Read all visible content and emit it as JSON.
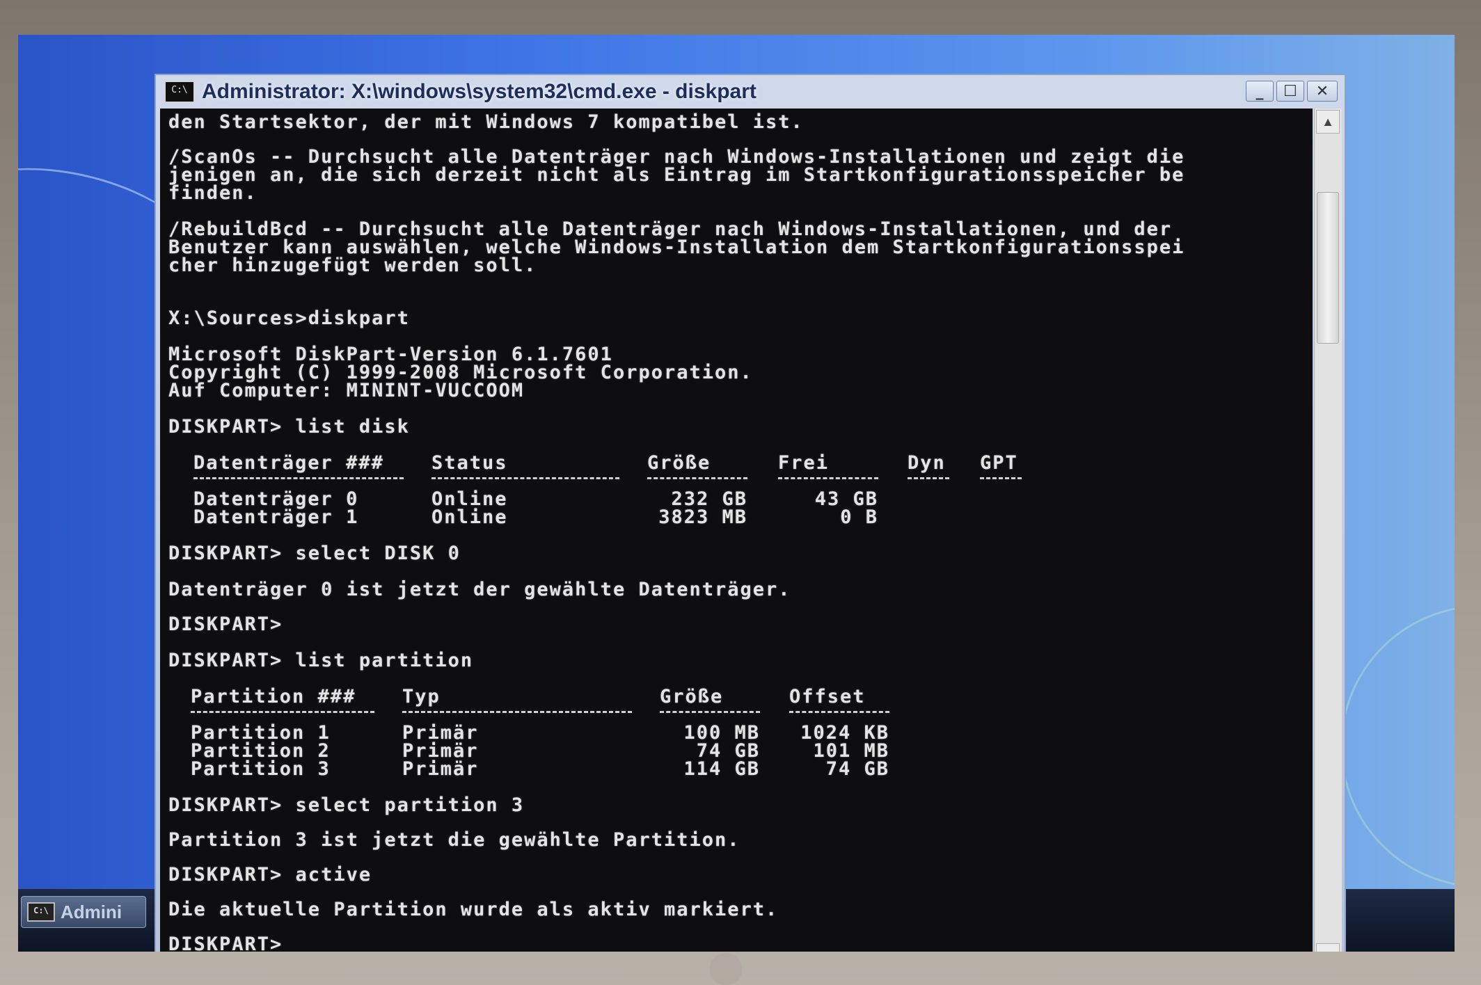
{
  "window": {
    "title": "Administrator: X:\\windows\\system32\\cmd.exe - diskpart",
    "icon_text": "C:\\",
    "controls": {
      "minimize": "_",
      "maximize": "☐",
      "close": "✕"
    }
  },
  "taskbar": {
    "button_label": "Admini",
    "button_icon_text": "C:\\"
  },
  "console": {
    "lines_top": [
      "den Startsektor, der mit Windows 7 kompatibel ist.",
      "/ScanOs -- Durchsucht alle Datenträger nach Windows-Installationen und zeigt die",
      "jenigen an, die sich derzeit nicht als Eintrag im Startkonfigurationsspeicher be",
      "finden.",
      "/RebuildBcd -- Durchsucht alle Datenträger nach Windows-Installationen, und der",
      "Benutzer kann auswählen, welche Windows-Installation dem Startkonfigurationsspei",
      "cher hinzugefügt werden soll.",
      "X:\\Sources>diskpart",
      "Microsoft DiskPart-Version 6.1.7601",
      "Copyright (C) 1999-2008 Microsoft Corporation.",
      "Auf Computer: MININT-VUCCOOM",
      "DISKPART> list disk"
    ],
    "disk_table": {
      "headers": [
        "Datenträger ###",
        "Status",
        "Größe",
        "Frei",
        "Dyn",
        "GPT"
      ],
      "rows": [
        [
          "Datenträger 0",
          "Online",
          "232 GB",
          "43 GB",
          "",
          ""
        ],
        [
          "Datenträger 1",
          "Online",
          "3823 MB",
          "0 B",
          "",
          ""
        ]
      ]
    },
    "lines_mid": [
      "DISKPART> select DISK 0",
      "Datenträger 0 ist jetzt der gewählte Datenträger.",
      "DISKPART>",
      "DISKPART> list partition"
    ],
    "partition_table": {
      "headers": [
        "Partition ###",
        "Typ",
        "Größe",
        "Offset"
      ],
      "rows": [
        [
          "Partition 1",
          "Primär",
          "100 MB",
          "1024 KB"
        ],
        [
          "Partition 2",
          "Primär",
          "74 GB",
          "101 MB"
        ],
        [
          "Partition 3",
          "Primär",
          "114 GB",
          "74 GB"
        ]
      ]
    },
    "lines_bottom": [
      "DISKPART> select partition 3",
      "Partition 3 ist jetzt die gewählte Partition.",
      "DISKPART> active",
      "Die aktuelle Partition wurde als aktiv markiert.",
      "DISKPART>"
    ]
  },
  "colors": {
    "console_bg": "#0e0e10",
    "console_text": "#e4e4e4",
    "title_text": "#1e2e5c",
    "desktop_blue": "#3e74e6"
  }
}
